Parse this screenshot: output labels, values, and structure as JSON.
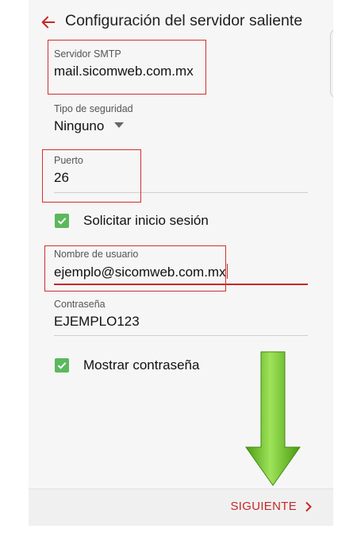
{
  "header": {
    "title": "Configuración del servidor saliente",
    "back_icon": "arrow-left-icon"
  },
  "form": {
    "smtp_server": {
      "label": "Servidor SMTP",
      "value": "mail.sicomweb.com.mx"
    },
    "security_type": {
      "label": "Tipo de seguridad",
      "value": "Ninguno"
    },
    "port": {
      "label": "Puerto",
      "value": "26"
    },
    "require_login": {
      "label": "Solicitar inicio sesión",
      "checked": true
    },
    "username": {
      "label": "Nombre de usuario",
      "value": "ejemplo@sicomweb.com.mx"
    },
    "password": {
      "label": "Contraseña",
      "value": "EJEMPLO123"
    },
    "show_password": {
      "label": "Mostrar contraseña",
      "checked": true
    }
  },
  "footer": {
    "next_label": "SIGUIENTE",
    "next_icon": "chevron-right-icon"
  },
  "colors": {
    "accent": "#c62828",
    "checkbox": "#5cb85c",
    "annotation_box": "#d32f2f",
    "annotation_arrow": "#5fb01c"
  }
}
